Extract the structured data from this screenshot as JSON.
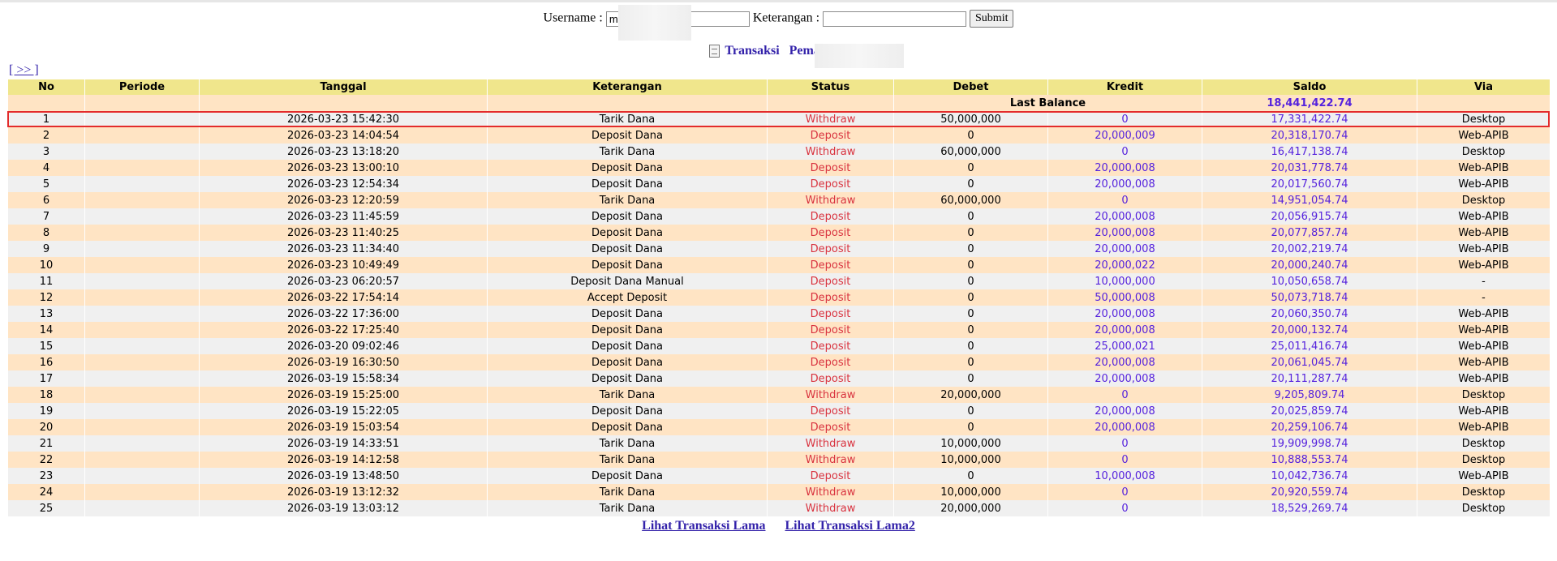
{
  "search": {
    "username_label": "Username :",
    "username_value": "m",
    "keterangan_label": "Keterangan :",
    "keterangan_value": "",
    "submit_label": "Submit"
  },
  "header": {
    "title": "Transaksi",
    "player_label": "Pemain : r"
  },
  "nav": {
    "next_label": "[ >> ]"
  },
  "table": {
    "columns": [
      "No",
      "Periode",
      "Tanggal",
      "Keterangan",
      "Status",
      "Debet",
      "Kredit",
      "Saldo",
      "Via"
    ],
    "last_balance_label": "Last Balance",
    "last_balance_value": "18,441,422.74",
    "rows": [
      {
        "no": "1",
        "periode": "",
        "tanggal": "2026-03-23 15:42:30",
        "keterangan": "Tarik Dana",
        "status": "Withdraw",
        "debet": "50,000,000",
        "kredit": "0",
        "saldo": "17,331,422.74",
        "via": "Desktop"
      },
      {
        "no": "2",
        "periode": "",
        "tanggal": "2026-03-23 14:04:54",
        "keterangan": "Deposit Dana",
        "status": "Deposit",
        "debet": "0",
        "kredit": "20,000,009",
        "saldo": "20,318,170.74",
        "via": "Web-APIB"
      },
      {
        "no": "3",
        "periode": "",
        "tanggal": "2026-03-23 13:18:20",
        "keterangan": "Tarik Dana",
        "status": "Withdraw",
        "debet": "60,000,000",
        "kredit": "0",
        "saldo": "16,417,138.74",
        "via": "Desktop"
      },
      {
        "no": "4",
        "periode": "",
        "tanggal": "2026-03-23 13:00:10",
        "keterangan": "Deposit Dana",
        "status": "Deposit",
        "debet": "0",
        "kredit": "20,000,008",
        "saldo": "20,031,778.74",
        "via": "Web-APIB"
      },
      {
        "no": "5",
        "periode": "",
        "tanggal": "2026-03-23 12:54:34",
        "keterangan": "Deposit Dana",
        "status": "Deposit",
        "debet": "0",
        "kredit": "20,000,008",
        "saldo": "20,017,560.74",
        "via": "Web-APIB"
      },
      {
        "no": "6",
        "periode": "",
        "tanggal": "2026-03-23 12:20:59",
        "keterangan": "Tarik Dana",
        "status": "Withdraw",
        "debet": "60,000,000",
        "kredit": "0",
        "saldo": "14,951,054.74",
        "via": "Desktop"
      },
      {
        "no": "7",
        "periode": "",
        "tanggal": "2026-03-23 11:45:59",
        "keterangan": "Deposit Dana",
        "status": "Deposit",
        "debet": "0",
        "kredit": "20,000,008",
        "saldo": "20,056,915.74",
        "via": "Web-APIB"
      },
      {
        "no": "8",
        "periode": "",
        "tanggal": "2026-03-23 11:40:25",
        "keterangan": "Deposit Dana",
        "status": "Deposit",
        "debet": "0",
        "kredit": "20,000,008",
        "saldo": "20,077,857.74",
        "via": "Web-APIB"
      },
      {
        "no": "9",
        "periode": "",
        "tanggal": "2026-03-23 11:34:40",
        "keterangan": "Deposit Dana",
        "status": "Deposit",
        "debet": "0",
        "kredit": "20,000,008",
        "saldo": "20,002,219.74",
        "via": "Web-APIB"
      },
      {
        "no": "10",
        "periode": "",
        "tanggal": "2026-03-23 10:49:49",
        "keterangan": "Deposit Dana",
        "status": "Deposit",
        "debet": "0",
        "kredit": "20,000,022",
        "saldo": "20,000,240.74",
        "via": "Web-APIB"
      },
      {
        "no": "11",
        "periode": "",
        "tanggal": "2026-03-23 06:20:57",
        "keterangan": "Deposit Dana Manual",
        "status": "Deposit",
        "debet": "0",
        "kredit": "10,000,000",
        "saldo": "10,050,658.74",
        "via": "-"
      },
      {
        "no": "12",
        "periode": "",
        "tanggal": "2026-03-22 17:54:14",
        "keterangan": "Accept Deposit",
        "status": "Deposit",
        "debet": "0",
        "kredit": "50,000,008",
        "saldo": "50,073,718.74",
        "via": "-"
      },
      {
        "no": "13",
        "periode": "",
        "tanggal": "2026-03-22 17:36:00",
        "keterangan": "Deposit Dana",
        "status": "Deposit",
        "debet": "0",
        "kredit": "20,000,008",
        "saldo": "20,060,350.74",
        "via": "Web-APIB"
      },
      {
        "no": "14",
        "periode": "",
        "tanggal": "2026-03-22 17:25:40",
        "keterangan": "Deposit Dana",
        "status": "Deposit",
        "debet": "0",
        "kredit": "20,000,008",
        "saldo": "20,000,132.74",
        "via": "Web-APIB"
      },
      {
        "no": "15",
        "periode": "",
        "tanggal": "2026-03-20 09:02:46",
        "keterangan": "Deposit Dana",
        "status": "Deposit",
        "debet": "0",
        "kredit": "25,000,021",
        "saldo": "25,011,416.74",
        "via": "Web-APIB"
      },
      {
        "no": "16",
        "periode": "",
        "tanggal": "2026-03-19 16:30:50",
        "keterangan": "Deposit Dana",
        "status": "Deposit",
        "debet": "0",
        "kredit": "20,000,008",
        "saldo": "20,061,045.74",
        "via": "Web-APIB"
      },
      {
        "no": "17",
        "periode": "",
        "tanggal": "2026-03-19 15:58:34",
        "keterangan": "Deposit Dana",
        "status": "Deposit",
        "debet": "0",
        "kredit": "20,000,008",
        "saldo": "20,111,287.74",
        "via": "Web-APIB"
      },
      {
        "no": "18",
        "periode": "",
        "tanggal": "2026-03-19 15:25:00",
        "keterangan": "Tarik Dana",
        "status": "Withdraw",
        "debet": "20,000,000",
        "kredit": "0",
        "saldo": "9,205,809.74",
        "via": "Desktop"
      },
      {
        "no": "19",
        "periode": "",
        "tanggal": "2026-03-19 15:22:05",
        "keterangan": "Deposit Dana",
        "status": "Deposit",
        "debet": "0",
        "kredit": "20,000,008",
        "saldo": "20,025,859.74",
        "via": "Web-APIB"
      },
      {
        "no": "20",
        "periode": "",
        "tanggal": "2026-03-19 15:03:54",
        "keterangan": "Deposit Dana",
        "status": "Deposit",
        "debet": "0",
        "kredit": "20,000,008",
        "saldo": "20,259,106.74",
        "via": "Web-APIB"
      },
      {
        "no": "21",
        "periode": "",
        "tanggal": "2026-03-19 14:33:51",
        "keterangan": "Tarik Dana",
        "status": "Withdraw",
        "debet": "10,000,000",
        "kredit": "0",
        "saldo": "19,909,998.74",
        "via": "Desktop"
      },
      {
        "no": "22",
        "periode": "",
        "tanggal": "2026-03-19 14:12:58",
        "keterangan": "Tarik Dana",
        "status": "Withdraw",
        "debet": "10,000,000",
        "kredit": "0",
        "saldo": "10,888,553.74",
        "via": "Desktop"
      },
      {
        "no": "23",
        "periode": "",
        "tanggal": "2026-03-19 13:48:50",
        "keterangan": "Deposit Dana",
        "status": "Deposit",
        "debet": "0",
        "kredit": "10,000,008",
        "saldo": "10,042,736.74",
        "via": "Web-APIB"
      },
      {
        "no": "24",
        "periode": "",
        "tanggal": "2026-03-19 13:12:32",
        "keterangan": "Tarik Dana",
        "status": "Withdraw",
        "debet": "10,000,000",
        "kredit": "0",
        "saldo": "20,920,559.74",
        "via": "Desktop"
      },
      {
        "no": "25",
        "periode": "",
        "tanggal": "2026-03-19 13:03:12",
        "keterangan": "Tarik Dana",
        "status": "Withdraw",
        "debet": "20,000,000",
        "kredit": "0",
        "saldo": "18,529,269.74",
        "via": "Desktop"
      }
    ]
  },
  "footer": {
    "old_tx_label": "Lihat Transaksi Lama",
    "old_tx2_label": "Lihat Transaksi Lama2"
  },
  "colors": {
    "header_bg": "#f0e68c",
    "row_odd_bg": "#ffe4c4",
    "row_even_bg": "#f0f0f0",
    "status_red": "#d9333f",
    "value_blue": "#5522dd",
    "link_blue": "#3322aa",
    "highlight_red": "#e32b2b"
  }
}
